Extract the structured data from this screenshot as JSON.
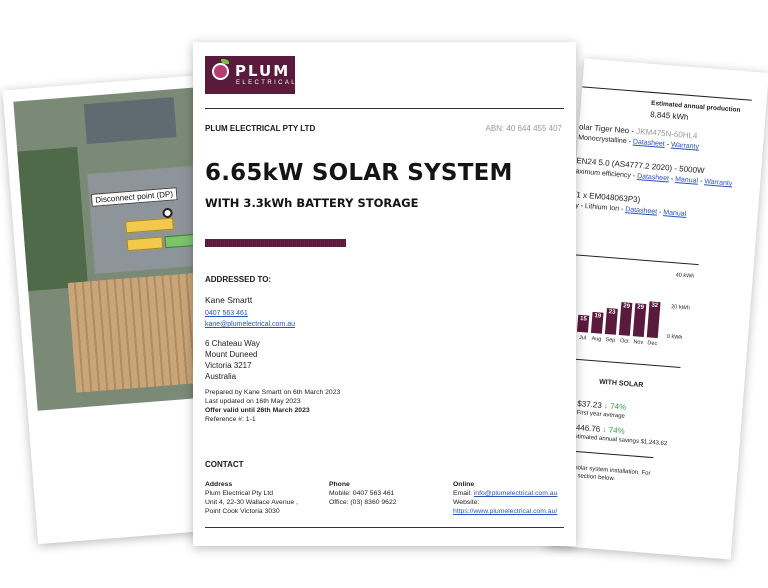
{
  "left_page": {
    "disconnect_label": "Disconnect point (DP)"
  },
  "header": {
    "logo_text": "PLUM",
    "logo_sub": "ELECTRICAL",
    "company": "PLUM ELECTRICAL PTY LTD",
    "abn": "ABN: 40 644 455 407"
  },
  "hero": {
    "title": "6.65kW SOLAR SYSTEM",
    "subtitle": "WITH 3.3kWh BATTERY STORAGE"
  },
  "addressed": {
    "heading": "ADDRESSED TO:",
    "name": "Kane Smartt",
    "phone": "0407 563 461",
    "email": "kane@plumelectrical.com.au",
    "street": "6 Chateau Way",
    "suburb": "Mount Duneed",
    "state": "Victoria 3217",
    "country": "Australia"
  },
  "meta": {
    "prepared": "Prepared by Kane Smartt on 6th March 2023",
    "updated": "Last updated on 16th May 2023",
    "offer": "Offer valid until 26th March 2023",
    "reference": "Reference #: 1-1"
  },
  "contact": {
    "heading": "CONTACT",
    "address_head": "Address",
    "address_lines": [
      "Plum Electrical Pty Ltd",
      "Unit 4, 22-30 Wallace Avenue ,",
      "Point Cook Victoria 3030"
    ],
    "phone_head": "Phone",
    "mobile": "Mobile: 0407 563 461",
    "office": "Office: (03) 8360 9622",
    "online_head": "Online",
    "email_label": "Email:",
    "email": "info@plumelectrical.com.au",
    "website_label": "Website:",
    "website": "https://www.plumelectrical.com.au/"
  },
  "right_page": {
    "est_label": "Estimated annual production",
    "est_value": "8,845 kWh",
    "panel_line": "olar Tiger Neo -",
    "panel_model": "JKM475N-60HL4",
    "panel_sub": "Monocrystalline -",
    "datasheet": "Datasheet",
    "warranty": "Warranty",
    "inverter_line": "EN24 5.0 (AS4777.2 2020) - 5000W",
    "inverter_sub": "aximum efficiency -",
    "manual": "Manual",
    "battery_line": "(1 x EM048063P3)",
    "battery_sub": "ry - Lithium Ion -",
    "chart_top": "40 kWh",
    "chart_mid": "20 kWh",
    "chart_bot": "0 kWh",
    "months": [
      "Jul",
      "Aug",
      "Sep",
      "Oct",
      "Nov",
      "Dec"
    ],
    "with_solar": "WITH SOLAR",
    "avg_value": "$37.23",
    "avg_pct": "↓ 74%",
    "avg_label": "First year average",
    "yr_value": "$446.76",
    "yr_pct": "↓ 74%",
    "yr_label": "Estimated annual savings $1,243.62",
    "footer1": "s to this solar system installation. For",
    "footer2": "Warranty section below."
  },
  "chart_data": {
    "type": "bar",
    "categories": [
      "",
      "Jul",
      "Aug",
      "Sep",
      "Oct",
      "Nov",
      "Dec"
    ],
    "values": [
      14,
      15,
      19,
      23,
      29,
      29,
      32
    ],
    "ylabel": "",
    "ylim": [
      0,
      40
    ]
  }
}
